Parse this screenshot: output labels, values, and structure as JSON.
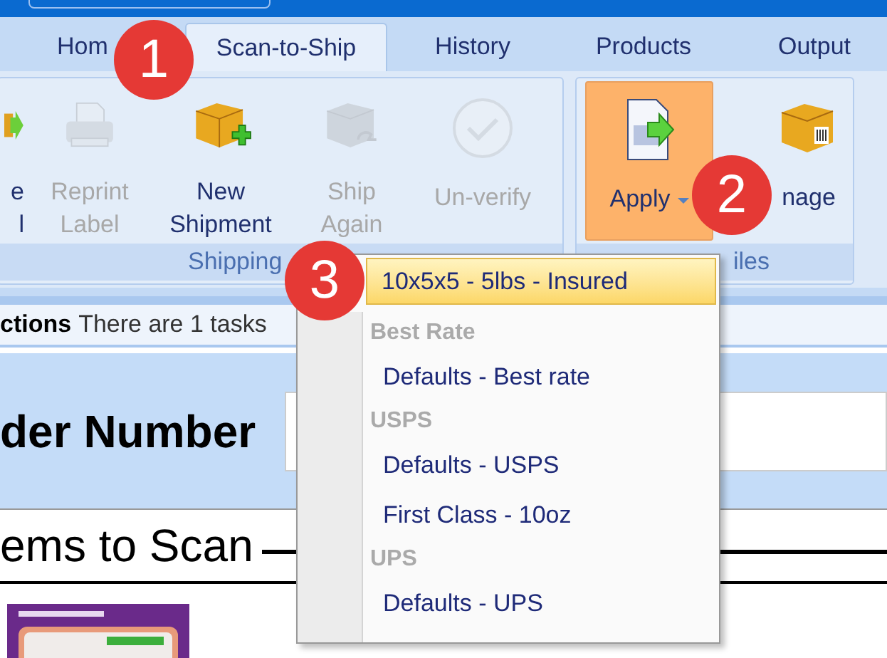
{
  "tabs": [
    {
      "label": "Hom",
      "selected": false
    },
    {
      "label": "Scan-to-Ship",
      "selected": true
    },
    {
      "label": "History",
      "selected": false
    },
    {
      "label": "Products",
      "selected": false
    },
    {
      "label": "Output",
      "selected": false
    }
  ],
  "ribbon_groups": [
    {
      "label": "Shipping",
      "buttons": [
        {
          "lines": [
            "e",
            "l"
          ],
          "disabled": false,
          "active": false
        },
        {
          "lines": [
            "Reprint",
            "Label"
          ],
          "disabled": true,
          "active": false
        },
        {
          "lines": [
            "New",
            "Shipment"
          ],
          "disabled": false,
          "active": false
        },
        {
          "lines": [
            "Ship",
            "Again"
          ],
          "disabled": true,
          "active": false
        },
        {
          "lines": [
            "Un-verify"
          ],
          "disabled": true,
          "active": false
        }
      ]
    },
    {
      "label": "iles",
      "buttons": [
        {
          "lines": [
            "Apply"
          ],
          "disabled": false,
          "active": true,
          "dropdown": true
        },
        {
          "lines": [
            "nage"
          ],
          "disabled": false,
          "active": false
        }
      ]
    }
  ],
  "instructions": {
    "title": "ctions",
    "text": "There are 1 tasks"
  },
  "order_number": {
    "label": "der Number"
  },
  "items_heading": "ems to Scan",
  "menu": [
    {
      "kind": "item",
      "label": "10x5x5 - 5lbs - Insured",
      "selected": true
    },
    {
      "kind": "header",
      "label": "Best Rate"
    },
    {
      "kind": "item",
      "label": "Defaults - Best rate",
      "selected": false
    },
    {
      "kind": "header",
      "label": "USPS"
    },
    {
      "kind": "item",
      "label": "Defaults - USPS",
      "selected": false
    },
    {
      "kind": "item",
      "label": "First Class - 10oz",
      "selected": false
    },
    {
      "kind": "header",
      "label": "UPS"
    },
    {
      "kind": "item",
      "label": "Defaults - UPS",
      "selected": false
    }
  ],
  "callouts": [
    "1",
    "2",
    "3"
  ]
}
